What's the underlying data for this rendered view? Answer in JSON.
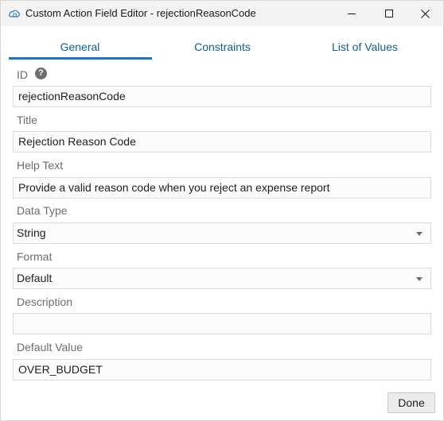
{
  "window": {
    "title": "Custom Action Field Editor - rejectionReasonCode"
  },
  "tabs": [
    {
      "label": "General",
      "selected": true
    },
    {
      "label": "Constraints",
      "selected": false
    },
    {
      "label": "List of Values",
      "selected": false
    }
  ],
  "fields": {
    "id": {
      "label": "ID",
      "value": "rejectionReasonCode"
    },
    "title": {
      "label": "Title",
      "value": "Rejection Reason Code"
    },
    "help_text": {
      "label": "Help Text",
      "value": "Provide a valid reason code when you reject an expense report"
    },
    "data_type": {
      "label": "Data Type",
      "value": "String"
    },
    "format": {
      "label": "Format",
      "value": "Default"
    },
    "description": {
      "label": "Description",
      "value": ""
    },
    "default_value": {
      "label": "Default Value",
      "value": "OVER_BUDGET"
    }
  },
  "help_icon_glyph": "?",
  "done_label": "Done",
  "colors": {
    "accent": "#1a76bf",
    "tab_text": "#0f5d95",
    "label_text": "#6c6c6c"
  }
}
